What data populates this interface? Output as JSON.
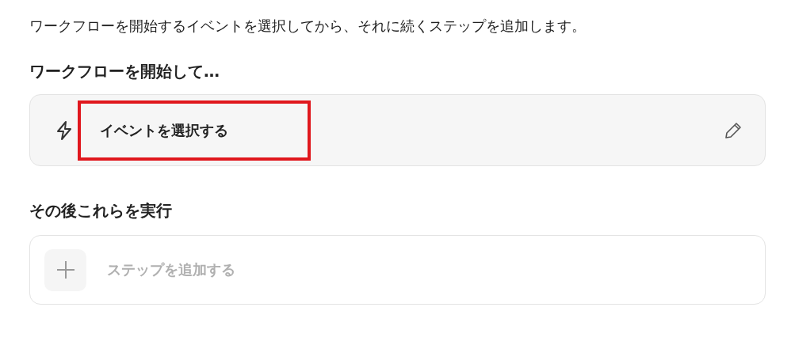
{
  "intro": "ワークフローを開始するイベントを選択してから、それに続くステップを追加します。",
  "trigger_section": {
    "heading": "ワークフローを開始して…",
    "trigger": {
      "label": "イベントを選択する",
      "highlighted": true
    }
  },
  "action_section": {
    "heading": "その後これらを実行",
    "step": {
      "label": "ステップを追加する",
      "disabled": true
    }
  }
}
